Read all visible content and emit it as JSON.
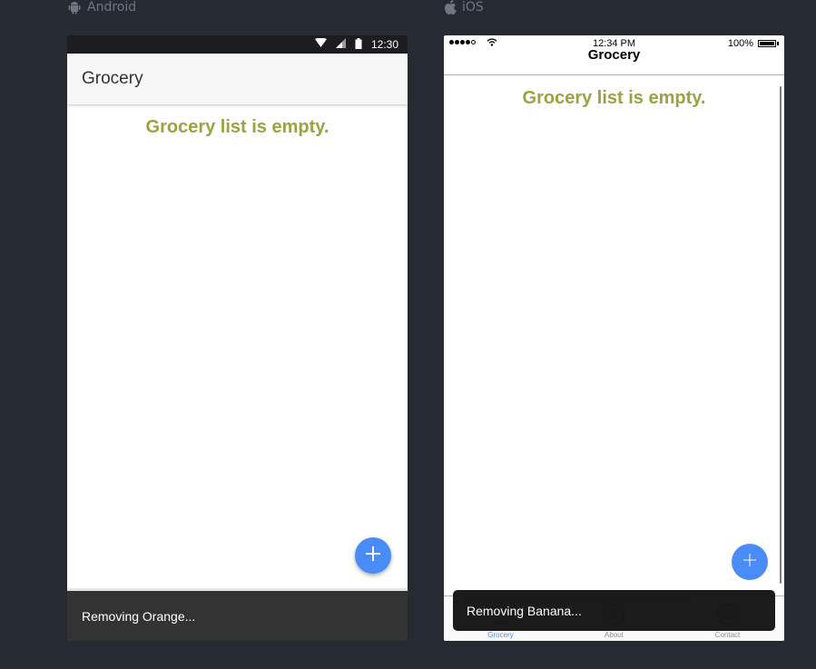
{
  "platforms": {
    "android_label": "Android",
    "ios_label": "iOS"
  },
  "android": {
    "status_time": "12:30",
    "toolbar_title": "Grocery",
    "empty_message": "Grocery list is empty.",
    "fab_icon": "plus-icon",
    "snackbar_text": "Removing Orange..."
  },
  "ios": {
    "status_time": "12:34 PM",
    "battery_percent": "100%",
    "nav_title": "Grocery",
    "empty_message": "Grocery list is empty.",
    "fab_icon": "plus-icon",
    "tabs": [
      {
        "label": "Grocery",
        "icon": "grocery-icon",
        "active": true
      },
      {
        "label": "About",
        "icon": "info-icon",
        "active": false
      },
      {
        "label": "Contact",
        "icon": "contact-icon",
        "active": false
      }
    ],
    "toast_text": "Removing Banana..."
  },
  "colors": {
    "background": "#252a33",
    "accent": "#4a8cf7",
    "empty_text": "#9aa33f",
    "snackbar": "#333333",
    "toast": "#141414"
  }
}
